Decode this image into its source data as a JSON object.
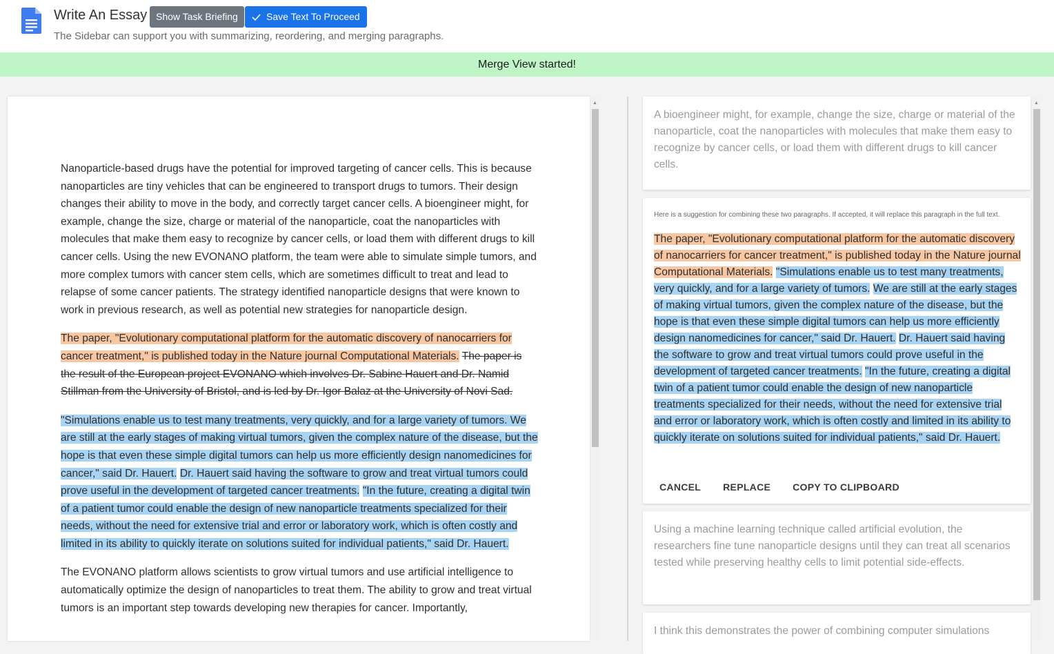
{
  "header": {
    "title": "Write An Essay",
    "briefing_button": "Show Task Briefing",
    "save_button": "Save Text To Proceed",
    "subtitle": "The Sidebar can support you with summarizing, reordering, and merging paragraphs."
  },
  "banner": {
    "message": "Merge View started!"
  },
  "document": {
    "p1": "Nanoparticle-based drugs have the potential for improved targeting of cancer cells. This is because nanoparticles are tiny vehicles that can be engineered to transport drugs to tumors. Their design changes their ability to move in the body, and correctly target cancer cells. A bioengineer might, for example, change the size, charge or material of the nanoparticle, coat the nanoparticles with molecules that make them easy to recognize by cancer cells, or load them with different drugs to kill cancer cells. Using the new EVONANO platform, the team were able to simulate simple tumors, and more complex tumors with cancer stem cells, which are sometimes difficult to treat and lead to relapse of some cancer patients. The strategy identified nanoparticle designs that were known to work in previous research, as well as potential new strategies for nanoparticle design.",
    "p2_highlight": "The paper, \"Evolutionary computational platform for the automatic discovery of nanocarriers for cancer treatment,\" is published today in the Nature journal Computational Materials.",
    "p2_strike": "The paper is the result of the European project EVONANO which involves Dr. Sabine Hauert and Dr. Namid Stillman from the University of Bristol, and is led by Dr. Igor Balaz at the University of Novi Sad.",
    "p3_s1": "\"Simulations enable us to test many treatments, very quickly, and for a large variety of tumors. We are still at the early stages of making virtual tumors, given the complex nature of the disease, but the hope is that even these simple digital tumors can help us more efficiently design nanomedicines for cancer,\" said Dr. Hauert.",
    "p3_s2": "Dr. Hauert said having the software to grow and treat virtual tumors could prove useful in the development of targeted cancer treatments.",
    "p3_s3": "\"In the future, creating a digital twin of a patient tumor could enable the design of new nanoparticle treatments specialized for their needs, without the need for extensive trial and error or laboratory work, which is often costly and limited in its ability to quickly iterate on solutions suited for individual patients,\" said Dr. Hauert.",
    "p4": "The EVONANO platform allows scientists to grow virtual tumors and use artificial intelligence to automatically optimize the design of nanoparticles to treat them. The ability to grow and treat virtual tumors is an important step towards developing new therapies for cancer. Importantly,"
  },
  "sidebar": {
    "card1": "A bioengineer might, for example, change the size, charge or material of the nanoparticle, coat the nanoparticles with molecules that make them easy to recognize by cancer cells, or load them with different drugs to kill cancer cells.",
    "merge": {
      "note": "Here is a suggestion for combining these two paragraphs. If accepted, it will replace this paragraph in the full text.",
      "orange": "The paper, \"Evolutionary computational platform for the automatic discovery of nanocarriers for cancer treatment,\" is published today in the Nature journal Computational Materials.",
      "blue1": "\"Simulations enable us to test many treatments, very quickly, and for a large variety of tumors.",
      "blue2": "We are still at the early stages of making virtual tumors, given the complex nature of the disease, but the hope is that even these simple digital tumors can help us more efficiently design nanomedicines for cancer,\" said Dr. Hauert.",
      "blue3": "Dr. Hauert said having the software to grow and treat virtual tumors could prove useful in the development of targeted cancer treatments.",
      "blue4": "\"In the future, creating a digital twin of a patient tumor could enable the design of new nanoparticle treatments specialized for their needs, without the need for extensive trial and error or laboratory work, which is often costly and limited in its ability to quickly iterate on solutions suited for individual patients,\" said Dr. Hauert.",
      "cancel": "CANCEL",
      "replace": "REPLACE",
      "copy": "COPY TO CLIPBOARD"
    },
    "card3": "Using a machine learning technique called artificial evolution, the researchers fine tune nanoparticle designs until they can treat all scenarios tested while preserving healthy cells to limit potential side-effects.",
    "card4": "I think this demonstrates the power of combining computer simulations"
  },
  "colors": {
    "highlight_orange": "#f7c7a3",
    "highlight_blue": "#a8d3f3",
    "banner_green": "#c0f5c7",
    "primary_blue": "#1a73e8"
  }
}
